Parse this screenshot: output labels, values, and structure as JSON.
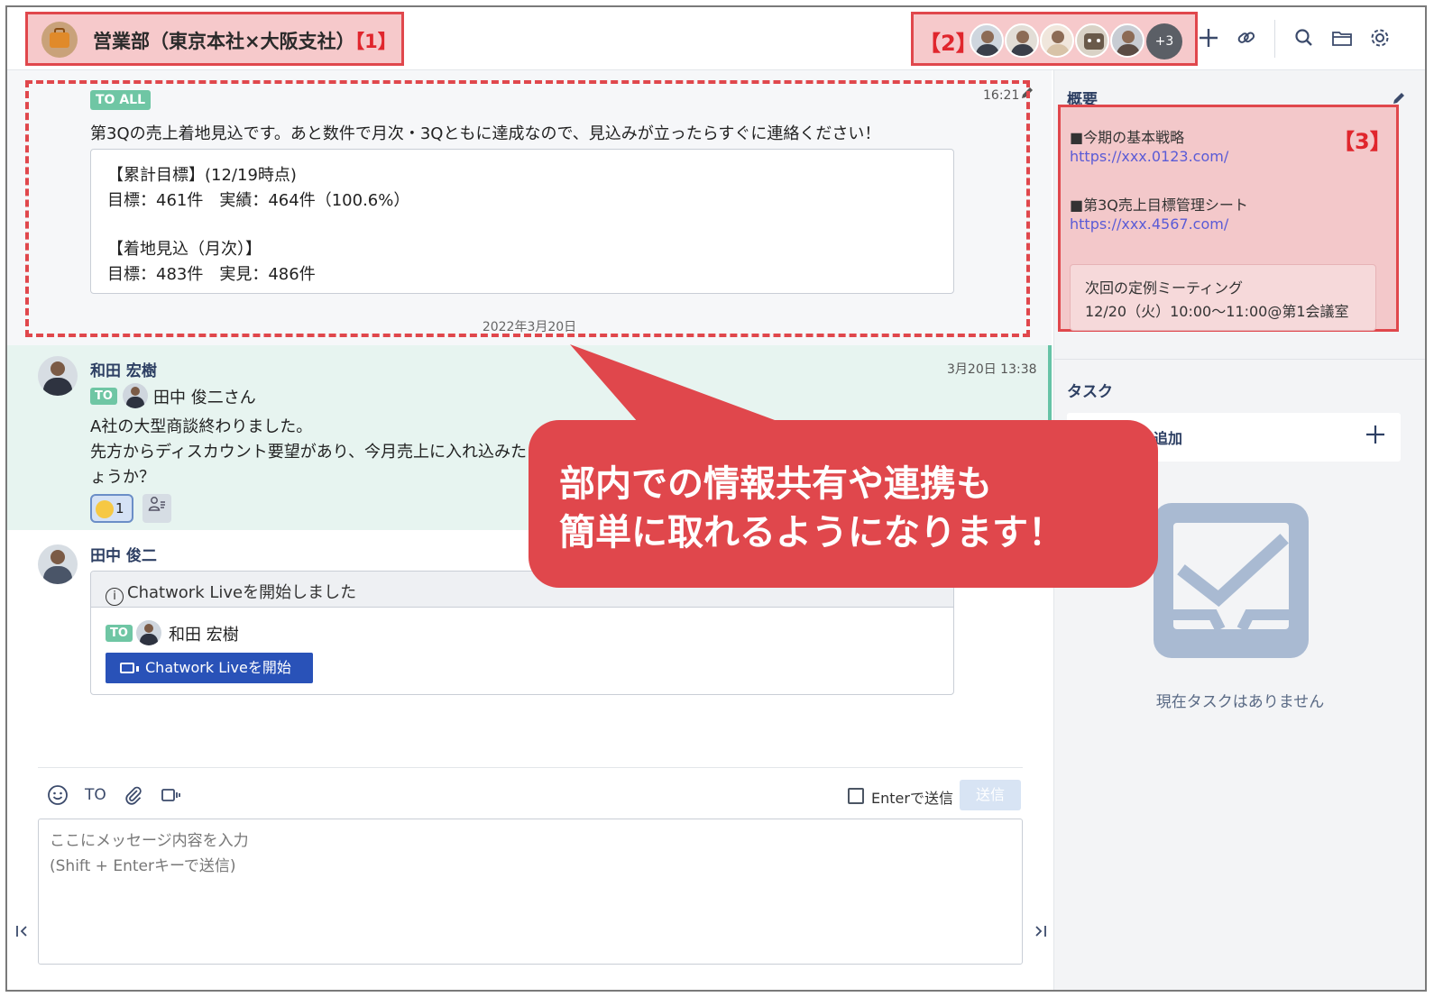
{
  "header": {
    "room_title": "営業部（東京本社×大阪支社）",
    "room_title_marker": "【1】",
    "members_marker": "【2】",
    "members_more": "+3",
    "icons": [
      "plus-icon",
      "link-icon",
      "search-icon",
      "folder-icon",
      "gear-icon"
    ]
  },
  "timeline": {
    "messages": [
      {
        "badge": "TO ALL",
        "time": "16:21",
        "text": "第3Qの売上着地見込です。あと数件で月次・3Qともに達成なので、見込みが立ったらすぐに連絡ください！",
        "quote_lines": [
          "【累計目標】(12/19時点)",
          "目標：461件　実績：464件（100.6%）",
          "",
          "【着地見込（月次）】",
          "目標：483件　実見：486件"
        ]
      },
      {
        "sender": "和田 宏樹",
        "time": "3月20日 13:38",
        "to_badge": "TO",
        "to_name": "田中 俊二さん",
        "lines": [
          "A社の大型商談終わりました。",
          "先方からディスカウント要望があり、今月売上に入れ込みた",
          "ょうか？"
        ],
        "reaction_count": "1"
      },
      {
        "sender": "田中 俊二",
        "live_card_title": "Chatwork Liveを開始しました",
        "to_badge": "TO",
        "to_name": "和田 宏樹",
        "live_button": "Chatwork Liveを開始"
      }
    ],
    "date_divider": "2022年3月20日"
  },
  "composer": {
    "toolbar_to": "TO",
    "enter_to_send_label": "Enterで送信",
    "send_label": "送信",
    "placeholder": "ここにメッセージ内容を入力\n(Shift + Enterキーで送信)"
  },
  "callout": {
    "line1": "部内での情報共有や連携も",
    "line2": "簡単に取れるようになります！"
  },
  "side": {
    "overview_heading": "概要",
    "overview_marker": "【3】",
    "overview_items": [
      {
        "label": "■今期の基本戦略",
        "link": "https://xxx.0123.com/"
      },
      {
        "label": "■第3Q売上目標管理シート",
        "link": "https://xxx.4567.com/"
      }
    ],
    "meeting_line1": "次回の定例ミーティング",
    "meeting_line2": "12/20（火）10:00〜11:00@第1会議室",
    "task_heading": "タスク",
    "task_add_label": "追加",
    "empty_task_label": "現在タスクはありません"
  },
  "colors": {
    "highlight_red": "#e0474c",
    "mention_green": "#6fc6a4",
    "button_blue": "#2952b8"
  }
}
